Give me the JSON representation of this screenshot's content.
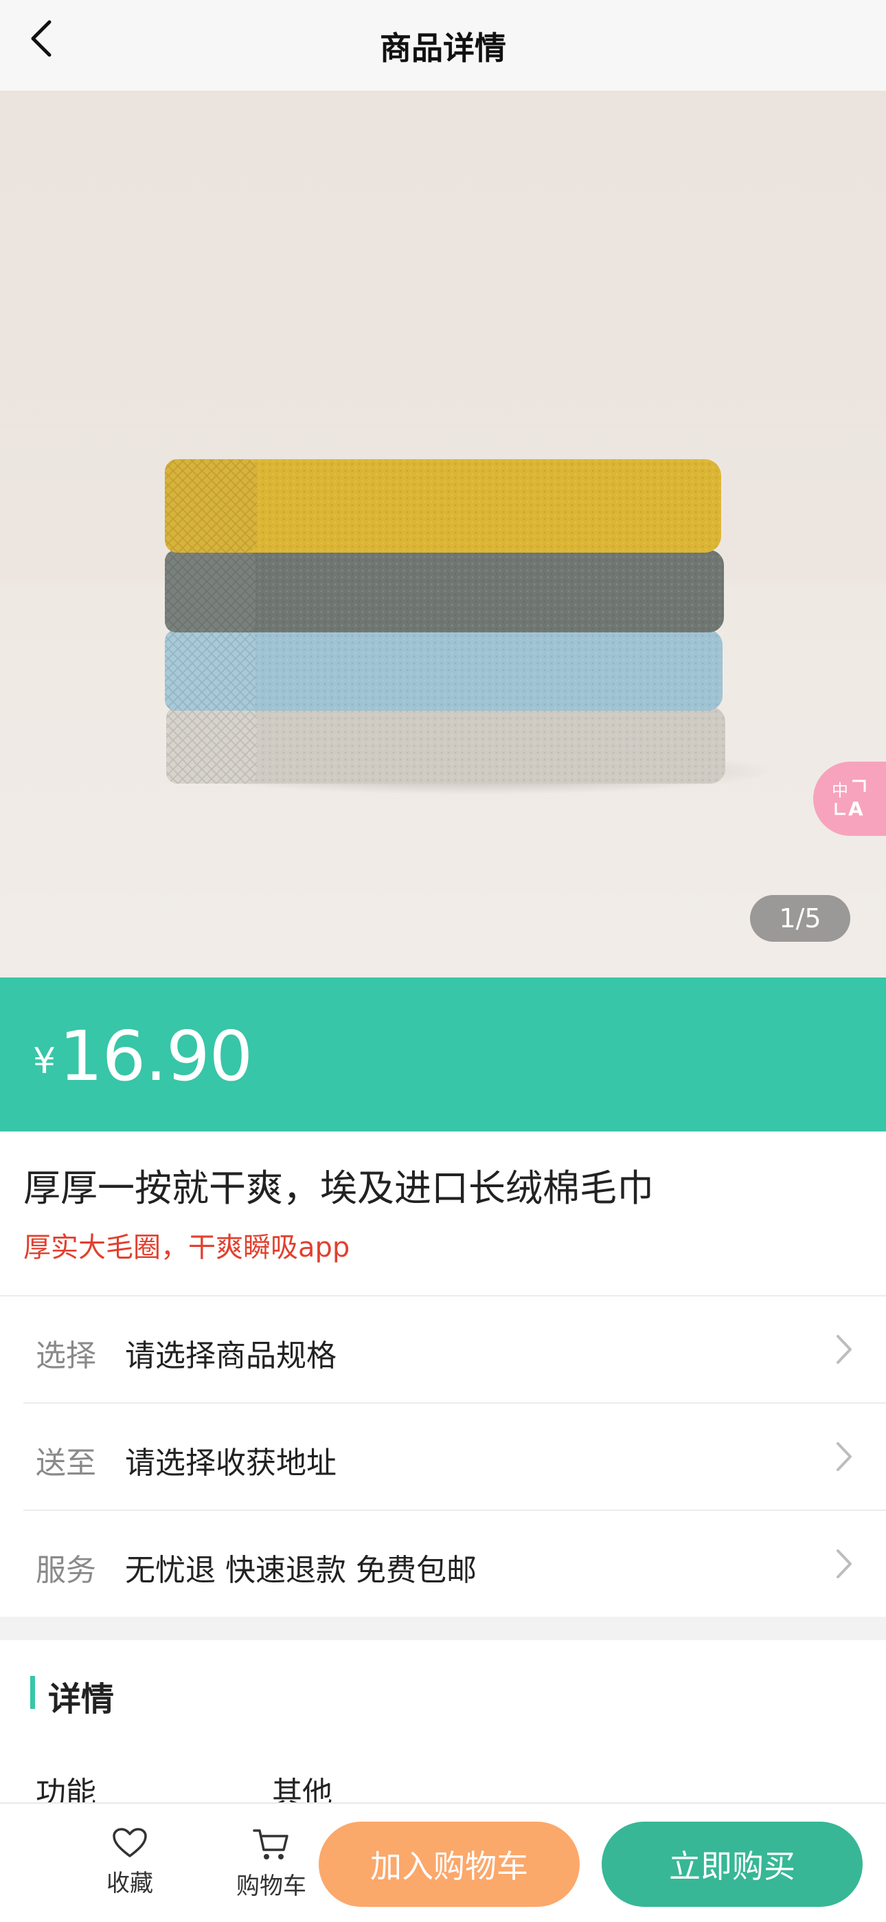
{
  "header": {
    "back_icon": "chevron-left-icon",
    "title": "商品详情"
  },
  "gallery": {
    "indicator": "1/5",
    "current": 1,
    "total": 5,
    "image_subject": "stack of folded towels (yellow, dark gray, light blue, beige)",
    "translate_icon": "translate-icon",
    "translate_bg": "#f7a3bd"
  },
  "price": {
    "symbol": "¥",
    "value": "16.90",
    "bg_color": "#37c6a7"
  },
  "product": {
    "title": "厚厚一按就干爽，埃及进口长绒棉毛巾",
    "subtitle": "厚实大毛圈，干爽瞬吸app",
    "subtitle_color": "#e2402f"
  },
  "options": [
    {
      "label": "选择",
      "value": "请选择商品规格"
    },
    {
      "label": "送至",
      "value": "请选择收获地址"
    },
    {
      "label": "服务",
      "value": "无忧退 快速退款 免费包邮"
    }
  ],
  "details": {
    "title": "详情",
    "keys": [
      "功能",
      "其他"
    ]
  },
  "bottom_bar": {
    "favorite_label": "收藏",
    "favorite_icon": "heart-icon",
    "cart_label": "购物车",
    "cart_icon": "cart-icon",
    "add_to_cart": "加入购物车",
    "buy_now": "立即购买",
    "add_to_cart_color": "#fba86b",
    "buy_now_color": "#37b796"
  }
}
